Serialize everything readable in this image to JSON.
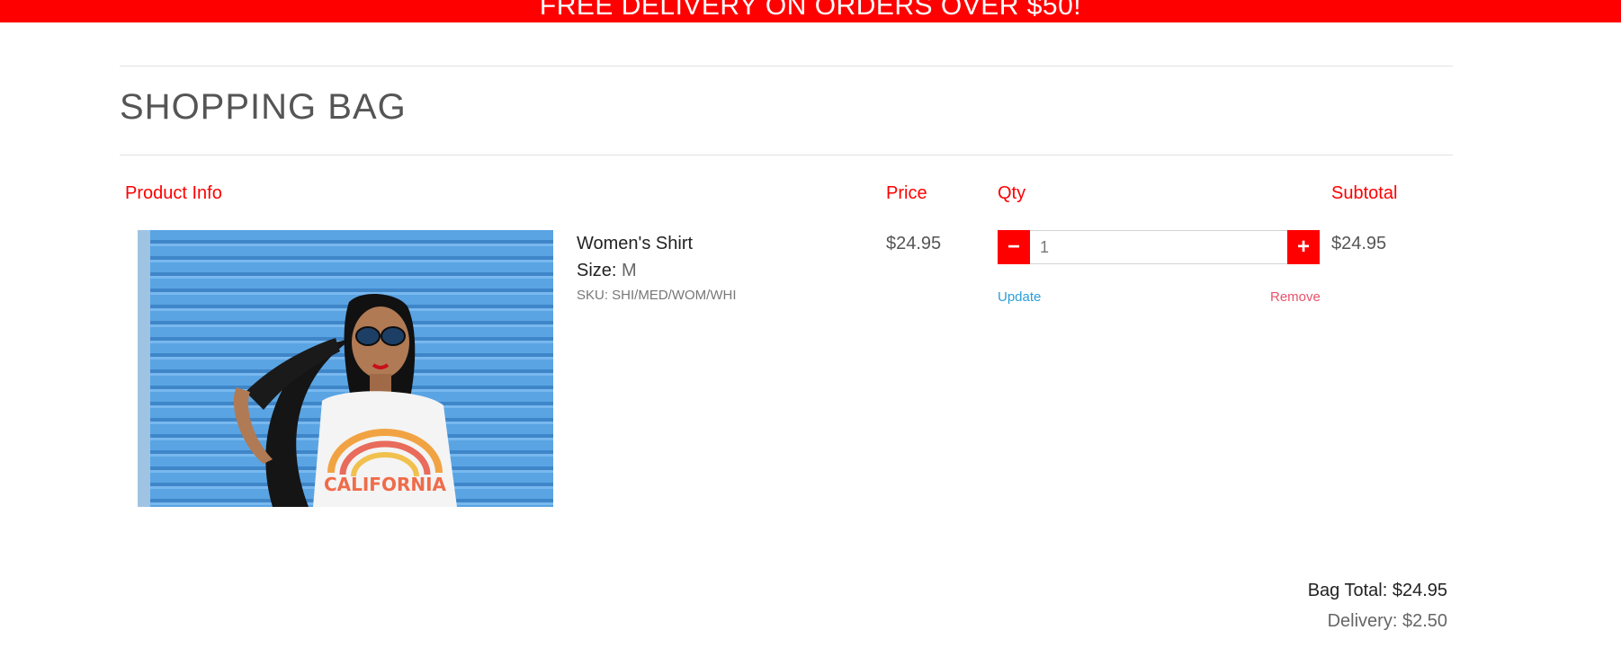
{
  "banner": {
    "text": "FREE DELIVERY ON ORDERS OVER $50!"
  },
  "page": {
    "title": "SHOPPING BAG"
  },
  "table": {
    "headers": {
      "product_info": "Product Info",
      "price": "Price",
      "qty": "Qty",
      "subtotal": "Subtotal"
    }
  },
  "item": {
    "name": "Women's Shirt",
    "size_label": "Size:",
    "size_value": "M",
    "sku": "SKU: SHI/MED/WOM/WHI",
    "price": "$24.95",
    "quantity": "1",
    "subtotal": "$24.95",
    "minus_label": "−",
    "plus_label": "+",
    "update_label": "Update",
    "remove_label": "Remove",
    "shirt_print": "CALIFORNIA"
  },
  "totals": {
    "bag_total": "Bag Total: $24.95",
    "delivery": "Delivery: $2.50"
  },
  "colors": {
    "accent": "#ff0000",
    "link": "#2a9fd6",
    "remove": "#e8536b"
  }
}
